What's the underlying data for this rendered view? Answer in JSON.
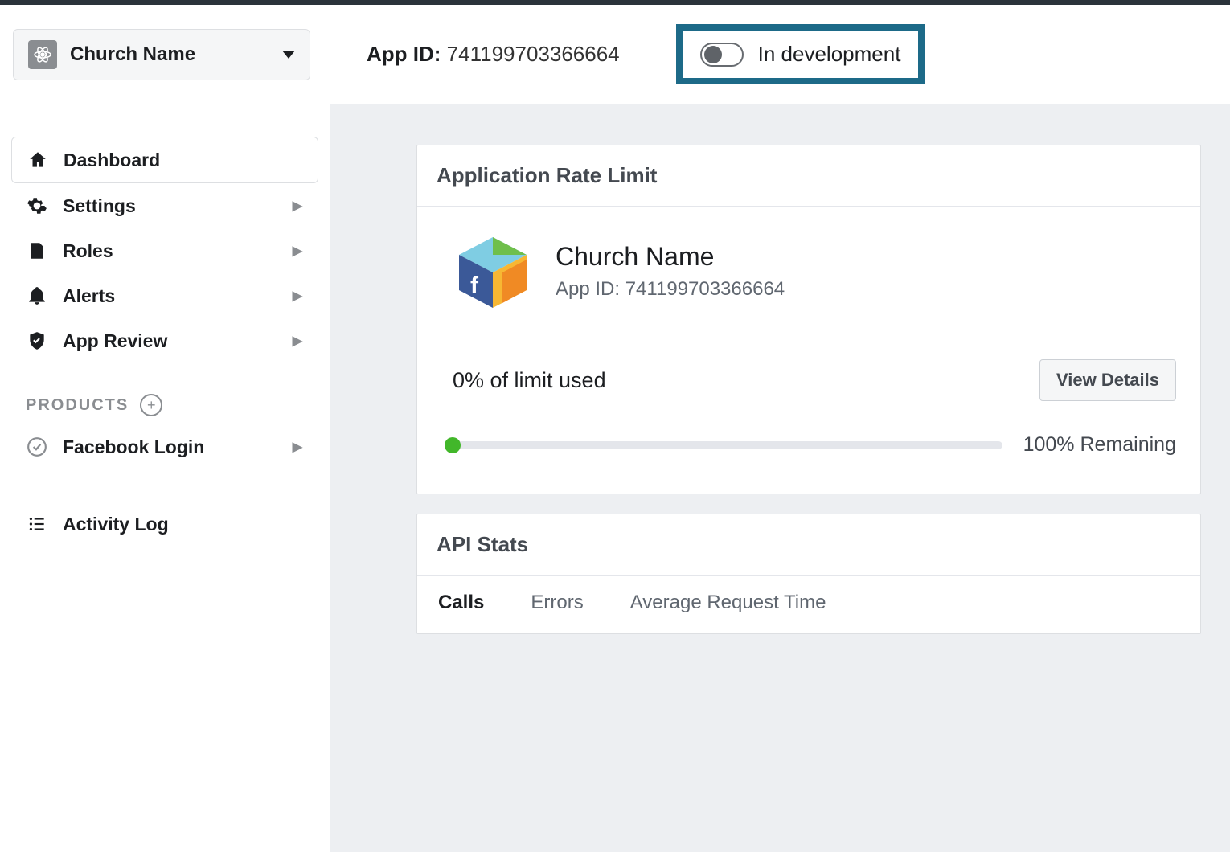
{
  "header": {
    "app_name": "Church Name",
    "app_id_label": "App ID:",
    "app_id_value": "741199703366664",
    "dev_status": "In development"
  },
  "sidebar": {
    "items": [
      {
        "label": "Dashboard",
        "icon": "home",
        "expandable": false,
        "active": true
      },
      {
        "label": "Settings",
        "icon": "gear",
        "expandable": true,
        "active": false
      },
      {
        "label": "Roles",
        "icon": "roles",
        "expandable": true,
        "active": false
      },
      {
        "label": "Alerts",
        "icon": "bell",
        "expandable": true,
        "active": false
      },
      {
        "label": "App Review",
        "icon": "shield",
        "expandable": true,
        "active": false
      }
    ],
    "products_label": "PRODUCTS",
    "products": [
      {
        "label": "Facebook Login",
        "icon": "check-circle",
        "expandable": true
      }
    ],
    "activity_log": "Activity Log"
  },
  "rate_limit": {
    "card_title": "Application Rate Limit",
    "app_name": "Church Name",
    "app_id_line": "App ID: 741199703366664",
    "used_text": "0% of limit used",
    "view_details": "View Details",
    "remaining_text": "100% Remaining",
    "percent_used": 0
  },
  "api_stats": {
    "card_title": "API Stats",
    "tabs": [
      "Calls",
      "Errors",
      "Average Request Time"
    ],
    "active_tab": "Calls"
  }
}
